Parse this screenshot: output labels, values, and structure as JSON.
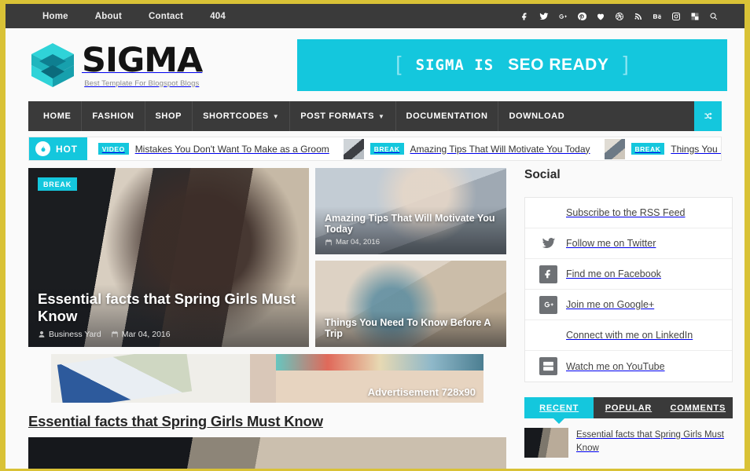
{
  "theme": {
    "accent": "#14c7dd",
    "dark": "#3a3a3a",
    "page_border": "#d9c236"
  },
  "topbar": {
    "nav": [
      {
        "label": "Home"
      },
      {
        "label": "About"
      },
      {
        "label": "Contact"
      },
      {
        "label": "404"
      }
    ],
    "social_icons": [
      {
        "name": "facebook-icon"
      },
      {
        "name": "twitter-icon"
      },
      {
        "name": "google-plus-icon"
      },
      {
        "name": "pinterest-icon"
      },
      {
        "name": "heart-icon"
      },
      {
        "name": "dribbble-icon"
      },
      {
        "name": "rss-icon"
      },
      {
        "name": "behance-icon"
      },
      {
        "name": "instagram-icon"
      },
      {
        "name": "delicious-icon"
      },
      {
        "name": "search-icon"
      }
    ]
  },
  "header": {
    "logo_title": "SIGMA",
    "logo_tagline": "Best Template For Blogspot Blogs",
    "banner": {
      "bracket_left": "[",
      "text_bold": "SIGMA IS",
      "text_light": "SEO READY",
      "bracket_right": "]"
    }
  },
  "mainnav": {
    "items": [
      {
        "label": "HOME",
        "caret": false
      },
      {
        "label": "FASHION",
        "caret": false
      },
      {
        "label": "SHOP",
        "caret": false
      },
      {
        "label": "SHORTCODES",
        "caret": true
      },
      {
        "label": "POST FORMATS",
        "caret": true
      },
      {
        "label": "DOCUMENTATION",
        "caret": false
      },
      {
        "label": "DOWNLOAD",
        "caret": false
      }
    ],
    "random_button": "random-post-icon"
  },
  "ticker": {
    "hot_label": "HOT",
    "items": [
      {
        "badge": "VIDEO",
        "title": "Mistakes You Don't Want To Make as a Groom",
        "has_thumb": false
      },
      {
        "badge": "BREAK",
        "title": "Amazing Tips That Will Motivate You Today",
        "has_thumb": true
      },
      {
        "badge": "BREAK",
        "title": "Things You Need To Know Before A",
        "has_thumb": true
      }
    ]
  },
  "featured": {
    "big": {
      "badge": "BREAK",
      "title": "Essential facts that Spring Girls Must Know",
      "author": "Business Yard",
      "date": "Mar 04, 2016"
    },
    "small": [
      {
        "title": "Amazing Tips That Will Motivate You Today",
        "date": "Mar 04, 2016"
      },
      {
        "title": "Things You Need To Know Before A Trip",
        "date": ""
      }
    ]
  },
  "ad": {
    "label": "Advertisement 728x90"
  },
  "post": {
    "title": "Essential facts that Spring Girls Must Know"
  },
  "sidebar": {
    "social_widget": {
      "title": "Social",
      "rows": [
        {
          "icon": "rss-icon",
          "icon_style": "blank",
          "label": "Subscribe to the RSS Feed"
        },
        {
          "icon": "twitter-icon",
          "icon_style": "plain",
          "label": "Follow me on Twitter"
        },
        {
          "icon": "facebook-icon",
          "icon_style": "sq",
          "label": "Find me on Facebook"
        },
        {
          "icon": "google-plus-icon",
          "icon_style": "sq",
          "label": "Join me on Google+"
        },
        {
          "icon": "linkedin-icon",
          "icon_style": "blank",
          "label": "Connect with me on LinkedIn"
        },
        {
          "icon": "youtube-icon",
          "icon_style": "sq",
          "label": "Watch me on YouTube"
        }
      ]
    },
    "tabs": [
      {
        "label": "RECENT",
        "active": true
      },
      {
        "label": "POPULAR",
        "active": false
      },
      {
        "label": "COMMENTS",
        "active": false
      }
    ],
    "tab_items": [
      {
        "title": "Essential facts that Spring Girls Must Know"
      }
    ]
  }
}
